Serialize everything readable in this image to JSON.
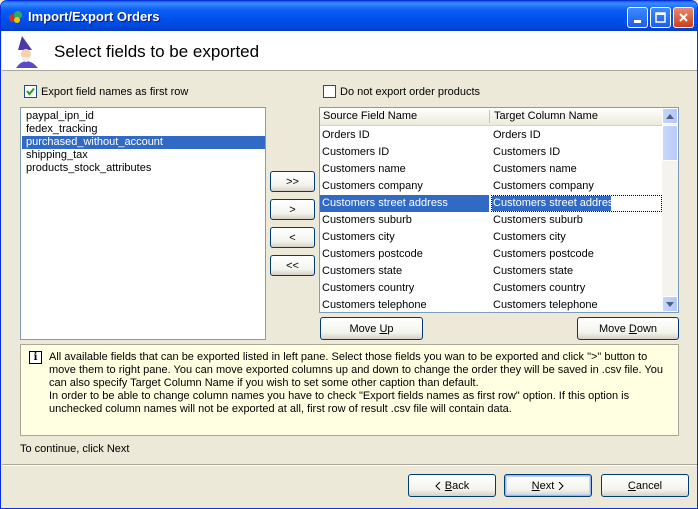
{
  "window": {
    "title": "Import/Export Orders"
  },
  "header": {
    "title": "Select fields to be exported"
  },
  "options": {
    "export_names": {
      "label": "Export field names as first row",
      "checked": true
    },
    "no_products": {
      "label": "Do not export order products",
      "checked": false
    }
  },
  "available_fields": [
    "paypal_ipn_id",
    "fedex_tracking",
    "purchased_without_account",
    "shipping_tax",
    "products_stock_attributes"
  ],
  "available_selected_index": 2,
  "transfer_buttons": {
    "add_all": ">>",
    "add": ">",
    "remove": "<",
    "remove_all": "<<"
  },
  "grid": {
    "col_source": "Source Field Name",
    "col_target": "Target Column Name",
    "selected_index": 4,
    "rows": [
      [
        "Orders ID",
        "Orders ID"
      ],
      [
        "Customers ID",
        "Customers ID"
      ],
      [
        "Customers name",
        "Customers name"
      ],
      [
        "Customers company",
        "Customers company"
      ],
      [
        "Customers street address",
        "Customers street address"
      ],
      [
        "Customers suburb",
        "Customers suburb"
      ],
      [
        "Customers city",
        "Customers city"
      ],
      [
        "Customers postcode",
        "Customers postcode"
      ],
      [
        "Customers state",
        "Customers state"
      ],
      [
        "Customers country",
        "Customers country"
      ],
      [
        "Customers telephone",
        "Customers telephone"
      ]
    ]
  },
  "move": {
    "up": "Move Up",
    "down": "Move Down"
  },
  "info": {
    "line1": "All available fields that can be exported listed in left pane. Select those fields you wan to be exported and click \">\" button to move them to right pane. You can move exported columns up and down to change the order they will be saved in .csv file. You can also specify Target Column Name if you wish to set some other caption than default.",
    "line2": "In order to be able to change column names you have to check \"Export fields names as first row\" option. If this option is unchecked column names will not be exported at all, first row of result .csv file will contain data."
  },
  "footer": {
    "continue_text": "To continue, click Next"
  },
  "buttons": {
    "back": "Back",
    "next": "Next",
    "cancel": "Cancel"
  }
}
